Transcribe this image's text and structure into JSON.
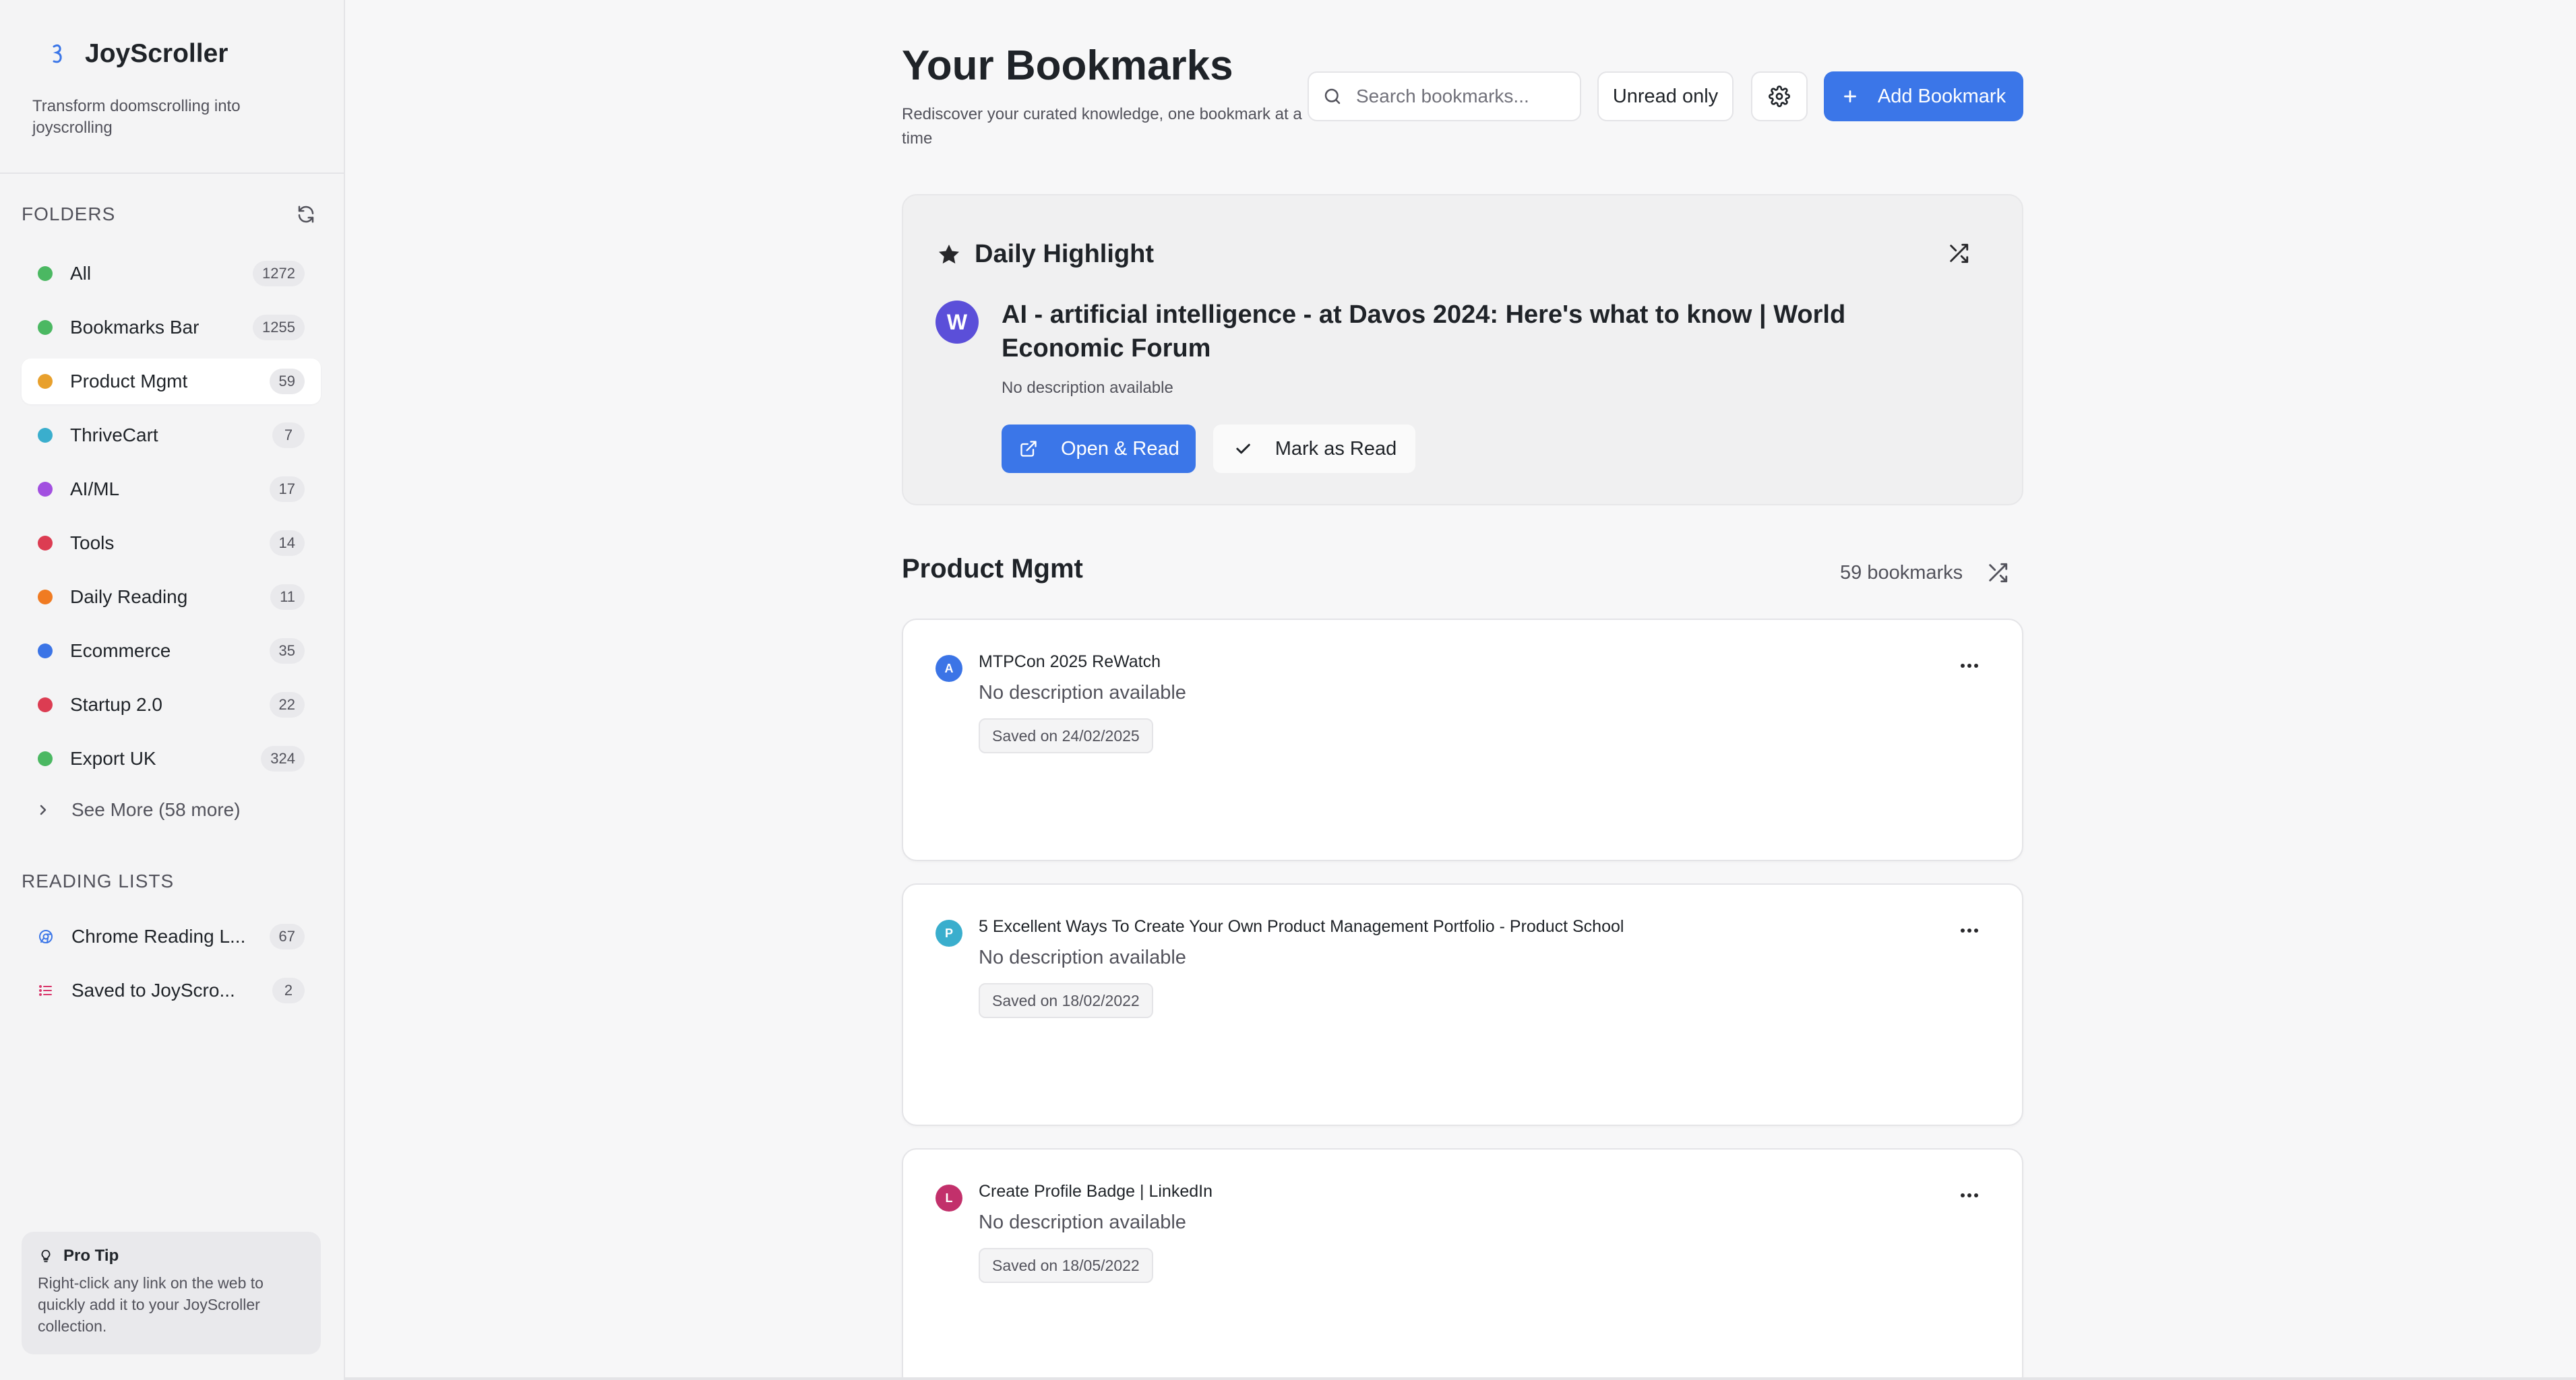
{
  "app": {
    "name": "JoyScroller",
    "tagline": "Transform doomscrolling into joyscrolling"
  },
  "sidebar": {
    "folders_heading": "FOLDERS",
    "folders": [
      {
        "label": "All",
        "count": "1272",
        "color": "#4bb862"
      },
      {
        "label": "Bookmarks Bar",
        "count": "1255",
        "color": "#4bb862"
      },
      {
        "label": "Product Mgmt",
        "count": "59",
        "color": "#e8a02c"
      },
      {
        "label": "ThriveCart",
        "count": "7",
        "color": "#3aaecd"
      },
      {
        "label": "AI/ML",
        "count": "17",
        "color": "#a24fe0"
      },
      {
        "label": "Tools",
        "count": "14",
        "color": "#dc3c52"
      },
      {
        "label": "Daily Reading",
        "count": "11",
        "color": "#f07b22"
      },
      {
        "label": "Ecommerce",
        "count": "35",
        "color": "#3b74e6"
      },
      {
        "label": "Startup 2.0",
        "count": "22",
        "color": "#dc3c52"
      },
      {
        "label": "Export UK",
        "count": "324",
        "color": "#4bb862"
      }
    ],
    "active_folder": "Product Mgmt",
    "see_more": "See More (58 more)",
    "reading_lists_heading": "READING LISTS",
    "reading_lists": [
      {
        "label": "Chrome Reading L...",
        "count": "67",
        "icon": "chrome-icon"
      },
      {
        "label": "Saved to JoyScro...",
        "count": "2",
        "icon": "list-icon"
      }
    ],
    "pro_tip": {
      "title": "Pro Tip",
      "body": "Right-click any link on the web to quickly add it to your JoyScroller collection."
    }
  },
  "header": {
    "title": "Your Bookmarks",
    "subtitle": "Rediscover your curated knowledge, one bookmark at a time",
    "search_placeholder": "Search bookmarks...",
    "unread_toggle": "Unread only",
    "add_button": "Add Bookmark"
  },
  "daily_highlight": {
    "heading": "Daily Highlight",
    "avatar_letter": "W",
    "title": "AI - artificial intelligence - at Davos 2024: Here's what to know | World Economic Forum",
    "description": "No description available",
    "open_label": "Open & Read",
    "mark_read_label": "Mark as Read"
  },
  "section": {
    "title": "Product Mgmt",
    "count_label": "59 bookmarks"
  },
  "bookmarks": [
    {
      "letter": "A",
      "avatar_color": "#3b74e6",
      "title": "MTPCon 2025 ReWatch",
      "description": "No description available",
      "saved": "Saved on 24/02/2025"
    },
    {
      "letter": "P",
      "avatar_color": "#3aaecd",
      "title": "5 Excellent Ways To Create Your Own Product Management Portfolio - Product School",
      "description": "No description available",
      "saved": "Saved on 18/02/2022"
    },
    {
      "letter": "L",
      "avatar_color": "#c2306b",
      "title": "Create Profile Badge | LinkedIn",
      "description": "No description available",
      "saved": "Saved on 18/05/2022"
    }
  ],
  "colors": {
    "accent": "#3b76e8",
    "sidebar_bg": "#f4f4f5",
    "page_bg": "#f7f7f8"
  }
}
